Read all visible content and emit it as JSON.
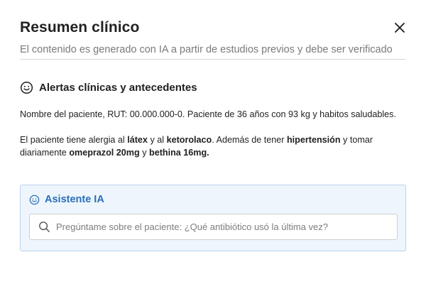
{
  "modal": {
    "title": "Resumen clínico",
    "subtitle": "El contenido es generado con IA a partir de estudios previos y debe ser verificado"
  },
  "alerts": {
    "section_title": "Alertas clínicas y antecedentes",
    "patient_line": "Nombre del paciente, RUT: 00.000.000-0. Paciente de 36 años con 93 kg y habitos saludables.",
    "allergy": {
      "t1": "El paciente tiene alergia al ",
      "b1": "látex",
      "t2": " y al ",
      "b2": "ketorolaco",
      "t3": ". Además de tener ",
      "b3": "hipertensión",
      "t4": " y tomar diariamente ",
      "b4": "omeprazol 20mg",
      "t5": " y ",
      "b5": "bethina 16mg."
    }
  },
  "assistant": {
    "title": "Asistente IA",
    "input_value": "",
    "input_placeholder": "Pregúntame sobre el paciente: ¿Qué antibiótico usó la última vez?"
  },
  "icons": {
    "close": "close-icon",
    "alerts": "smiley-icon",
    "assistant": "smiley-icon",
    "search": "search-icon"
  },
  "colors": {
    "accent": "#2a6fb8",
    "assistant_bg": "#eef5fd",
    "assistant_border": "#b9d4ef"
  }
}
